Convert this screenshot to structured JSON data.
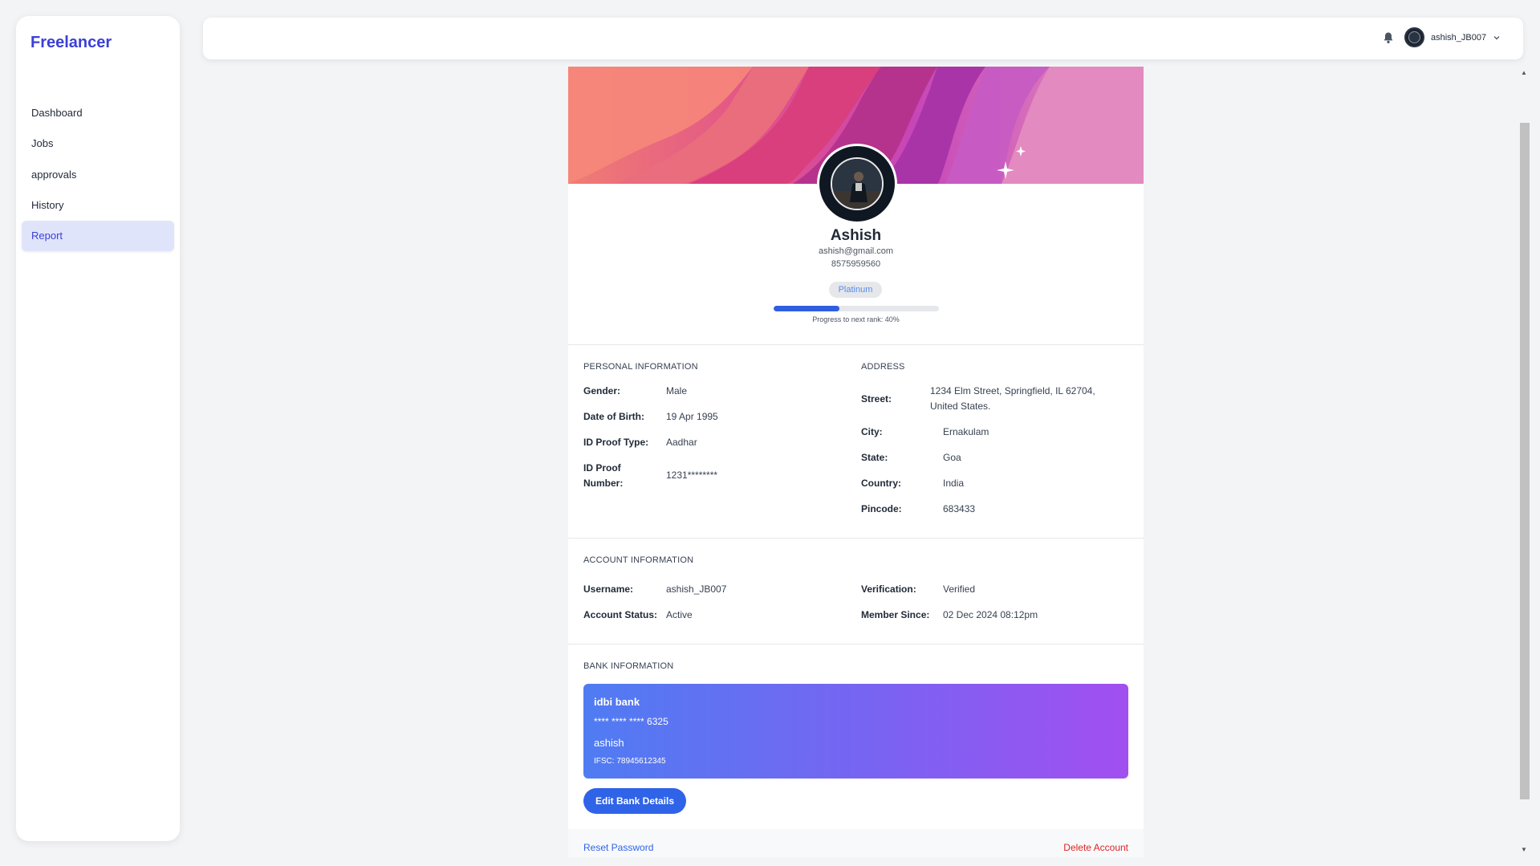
{
  "sidebar": {
    "brand": "Freelancer",
    "items": [
      {
        "label": "Dashboard",
        "active": false
      },
      {
        "label": "Jobs",
        "active": false
      },
      {
        "label": "approvals",
        "active": false
      },
      {
        "label": "History",
        "active": false
      },
      {
        "label": "Report",
        "active": true
      }
    ]
  },
  "topbar": {
    "username": "ashish_JB007",
    "icons": [
      "bell-icon",
      "avatar",
      "chevron-down-icon"
    ]
  },
  "profile": {
    "name": "Ashish",
    "email": "ashish@gmail.com",
    "phone": "8575959560",
    "rank_badge": "Platinum",
    "progress_percent": 40,
    "progress_label": "Progress to next rank: 40%"
  },
  "personal": {
    "title": "PERSONAL INFORMATION",
    "gender_label": "Gender:",
    "gender": "Male",
    "dob_label": "Date of Birth:",
    "dob": "19 Apr 1995",
    "id_type_label": "ID Proof Type:",
    "id_type": "Aadhar",
    "id_number_label_1": "ID Proof",
    "id_number_label_2": "Number:",
    "id_number": "1231********"
  },
  "address": {
    "title": "ADDRESS",
    "street_label": "Street:",
    "street_line1": "1234 Elm Street, Springfield, IL 62704,",
    "street_line2": "United States.",
    "city_label": "City:",
    "city": "Ernakulam",
    "state_label": "State:",
    "state": "Goa",
    "country_label": "Country:",
    "country": "India",
    "pincode_label": "Pincode:",
    "pincode": "683433"
  },
  "account": {
    "title": "ACCOUNT INFORMATION",
    "username_label": "Username:",
    "username": "ashish_JB007",
    "status_label": "Account Status:",
    "status": "Active",
    "verification_label": "Verification:",
    "verification": "Verified",
    "member_since_label": "Member Since:",
    "member_since": "02 Dec 2024 08:12pm"
  },
  "bank": {
    "title": "BANK INFORMATION",
    "bank_name": "idbi bank",
    "card_number": "**** **** **** 6325",
    "holder": "ashish",
    "ifsc": "IFSC: 78945612345",
    "edit_label": "Edit Bank Details"
  },
  "footer": {
    "reset_label": "Reset Password",
    "delete_label": "Delete Account"
  },
  "colors": {
    "brand": "#3b3fd8",
    "accent": "#2f63e8",
    "danger": "#e02424"
  }
}
